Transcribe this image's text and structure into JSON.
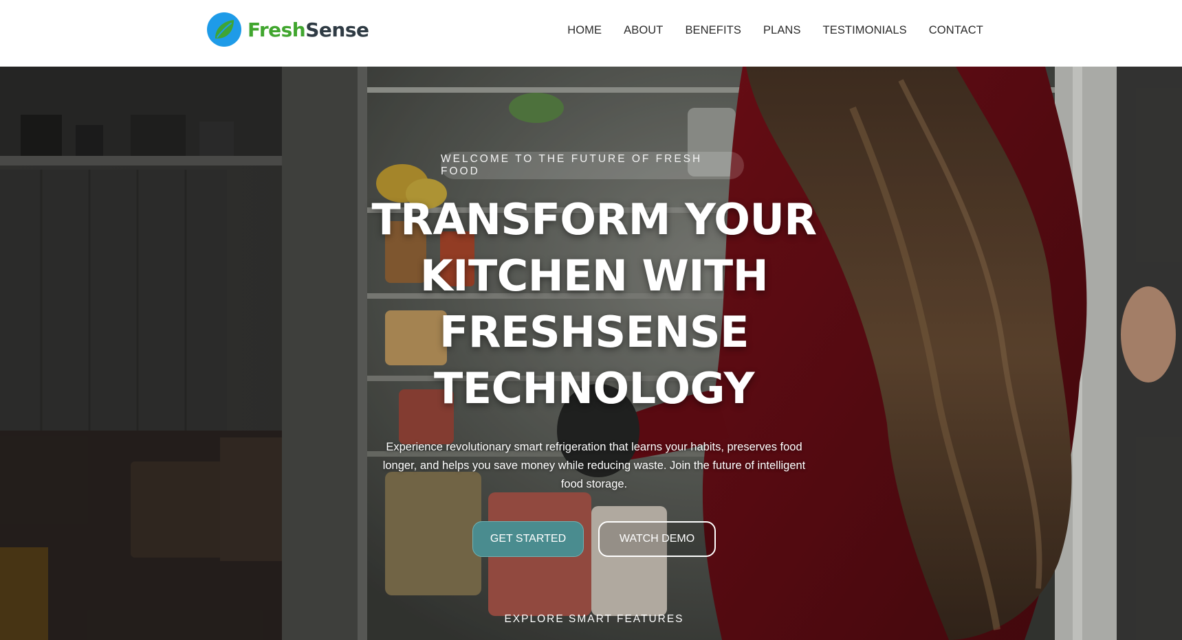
{
  "brand": {
    "name_part1": "Fresh",
    "name_part2": "Sense",
    "colors": {
      "fresh": "#41a62f",
      "sense": "#2f3b44",
      "icon_blue": "#1e9be8",
      "icon_leaf": "#3fa535"
    }
  },
  "nav": {
    "items": [
      {
        "label": "HOME"
      },
      {
        "label": "ABOUT"
      },
      {
        "label": "BENEFITS"
      },
      {
        "label": "PLANS"
      },
      {
        "label": "TESTIMONIALS"
      },
      {
        "label": "CONTACT"
      }
    ]
  },
  "hero": {
    "tagline": "WELCOME TO THE FUTURE OF FRESH FOOD",
    "headline_lines": [
      "TRANSFORM YOUR",
      "KITCHEN WITH",
      "FRESHSENSE",
      "TECHNOLOGY"
    ],
    "subtext": "Experience revolutionary smart refrigeration that learns your habits, preserves food longer, and helps you save money while reducing waste. Join the future of intelligent food storage.",
    "primary_button": "GET STARTED",
    "secondary_button": "WATCH DEMO",
    "explore_link": "EXPLORE SMART FEATURES",
    "colors": {
      "primary_button_bg": "#4a8c8f",
      "secondary_button_border": "#ffffff"
    }
  }
}
